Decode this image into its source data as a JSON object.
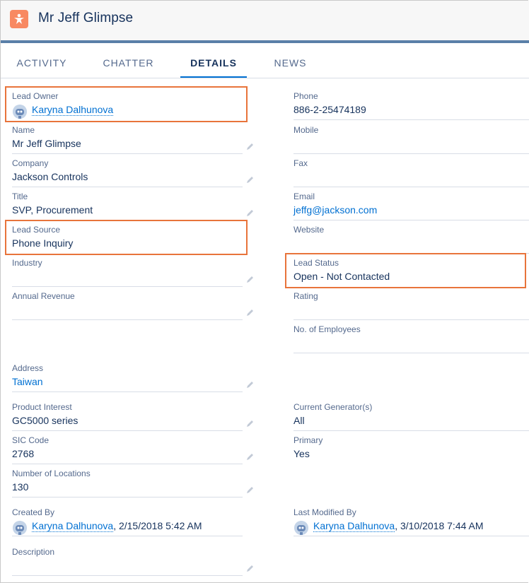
{
  "record": {
    "title": "Mr Jeff Glimpse",
    "icon": "lead-icon",
    "icon_color": "#f88962"
  },
  "tabs": [
    {
      "label": "ACTIVITY",
      "active": false
    },
    {
      "label": "CHATTER",
      "active": false
    },
    {
      "label": "DETAILS",
      "active": true
    },
    {
      "label": "NEWS",
      "active": false
    }
  ],
  "left_fields": {
    "lead_owner": {
      "label": "Lead Owner",
      "value": "Karyna Dalhunova"
    },
    "name": {
      "label": "Name",
      "value": "Mr Jeff Glimpse"
    },
    "company": {
      "label": "Company",
      "value": "Jackson Controls"
    },
    "title": {
      "label": "Title",
      "value": "SVP, Procurement"
    },
    "lead_source": {
      "label": "Lead Source",
      "value": "Phone Inquiry"
    },
    "industry": {
      "label": "Industry",
      "value": ""
    },
    "annual_revenue": {
      "label": "Annual Revenue",
      "value": ""
    },
    "address": {
      "label": "Address",
      "value": "Taiwan"
    },
    "product_interest": {
      "label": "Product Interest",
      "value": "GC5000 series"
    },
    "sic_code": {
      "label": "SIC Code",
      "value": "2768"
    },
    "number_of_locations": {
      "label": "Number of Locations",
      "value": "130"
    },
    "created_by": {
      "label": "Created By",
      "user": "Karyna Dalhunova",
      "date": ", 2/15/2018 5:42 AM"
    },
    "description": {
      "label": "Description",
      "value": ""
    }
  },
  "right_fields": {
    "phone": {
      "label": "Phone",
      "value": "886-2-25474189"
    },
    "mobile": {
      "label": "Mobile",
      "value": ""
    },
    "fax": {
      "label": "Fax",
      "value": ""
    },
    "email": {
      "label": "Email",
      "value": "jeffg@jackson.com"
    },
    "website": {
      "label": "Website",
      "value": ""
    },
    "lead_status": {
      "label": "Lead Status",
      "value": "Open - Not Contacted"
    },
    "rating": {
      "label": "Rating",
      "value": ""
    },
    "no_of_employees": {
      "label": "No. of Employees",
      "value": ""
    },
    "current_generators": {
      "label": "Current Generator(s)",
      "value": "All"
    },
    "primary": {
      "label": "Primary",
      "value": "Yes"
    },
    "last_modified_by": {
      "label": "Last Modified By",
      "user": "Karyna Dalhunova",
      "date": ", 3/10/2018 7:44 AM"
    }
  },
  "colors": {
    "highlight": "#e8743b",
    "link": "#0070d2",
    "active_tab": "#0070d2",
    "header_band": "#5a7fa8"
  }
}
